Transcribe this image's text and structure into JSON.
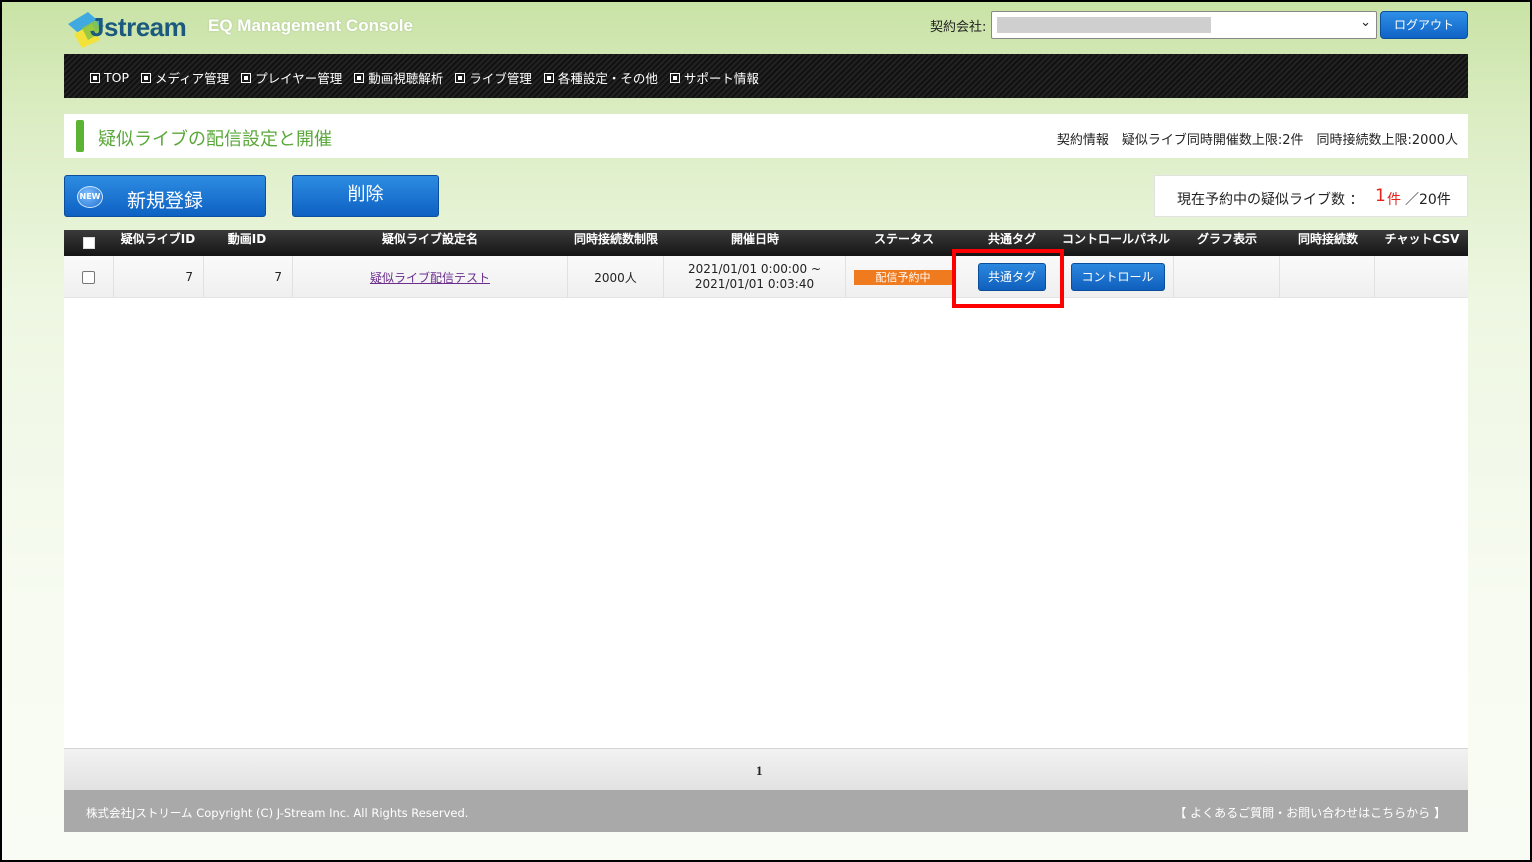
{
  "header": {
    "logo_text": "Jstream",
    "console_title": "EQ Management Console",
    "company_label": "契約会社:",
    "company_selected": "",
    "logout_label": "ログアウト"
  },
  "nav": {
    "items": [
      "TOP",
      "メディア管理",
      "プレイヤー管理",
      "動画視聴解析",
      "ライブ管理",
      "各種設定・その他",
      "サポート情報"
    ]
  },
  "page": {
    "title": "疑似ライブの配信設定と開催",
    "contract_info": "契約情報　疑似ライブ同時開催数上限:2件　同時接続数上限:2000人"
  },
  "actions": {
    "new_badge": "NEW",
    "new_label": "新規登録",
    "delete_label": "削除"
  },
  "reservation": {
    "label": "現在予約中の疑似ライブ数 ：",
    "count": "1",
    "unit": "件",
    "max": "／20件"
  },
  "table": {
    "headers": [
      "疑似ライブID",
      "動画ID",
      "疑似ライブ設定名",
      "同時接続数制限",
      "開催日時",
      "ステータス",
      "共通タグ",
      "コントロールパネル",
      "グラフ表示",
      "同時接続数",
      "チャットCSV"
    ],
    "rows": [
      {
        "live_id": "7",
        "video_id": "7",
        "name": "疑似ライブ配信テスト",
        "limit": "2000人",
        "start": "2021/01/01 0:00:00 ~",
        "end": "2021/01/01 0:03:40",
        "status": "配信予約中",
        "tag_button": "共通タグ",
        "control_button": "コントロール"
      }
    ]
  },
  "pagination": {
    "current": "1"
  },
  "footer": {
    "copyright": "株式会社Jストリーム  Copyright (C) J-Stream Inc. All Rights Reserved.",
    "faq": "【 よくあるご質問・お問い合わせはこちらから 】"
  },
  "colors": {
    "accent_green": "#5aa83a",
    "button_blue": "#0f63c6",
    "status_orange": "#f07a1e",
    "highlight_red": "#ff0000",
    "count_red": "#e6221c"
  }
}
